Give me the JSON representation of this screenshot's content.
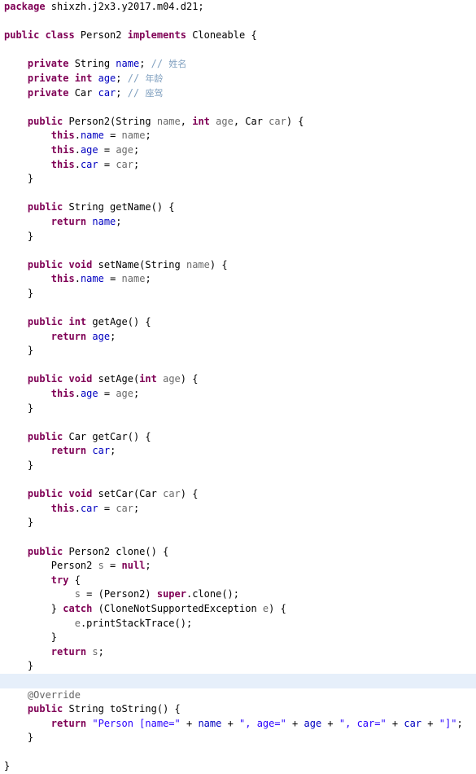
{
  "editor": {
    "language": "java",
    "filename": "Person2.java",
    "highlight_color": "#e6effa",
    "colors": {
      "background": "#ffffff",
      "keyword": "#7f0055",
      "field": "#0000c0",
      "string": "#2a00ff",
      "comment": "#7f9fbf",
      "annotation": "#646464",
      "local": "#6a6a6a",
      "plain": "#000000"
    },
    "lines": [
      {
        "indent": 0,
        "highlight": false,
        "tokens": [
          {
            "t": "package ",
            "c": "kw"
          },
          {
            "t": "shixzh.j2x3.y2017.m04.d21;",
            "c": "plain"
          }
        ]
      },
      {
        "indent": 0,
        "highlight": false,
        "tokens": []
      },
      {
        "indent": 0,
        "highlight": false,
        "tokens": [
          {
            "t": "public class ",
            "c": "kw"
          },
          {
            "t": "Person2 ",
            "c": "plain"
          },
          {
            "t": "implements ",
            "c": "kw"
          },
          {
            "t": "Cloneable {",
            "c": "plain"
          }
        ]
      },
      {
        "indent": 0,
        "highlight": false,
        "tokens": []
      },
      {
        "indent": 1,
        "highlight": false,
        "tokens": [
          {
            "t": "private ",
            "c": "kw"
          },
          {
            "t": "String ",
            "c": "plain"
          },
          {
            "t": "name",
            "c": "fld"
          },
          {
            "t": "; ",
            "c": "plain"
          },
          {
            "t": "// ",
            "c": "cmt"
          },
          {
            "t": "姓名",
            "c": "cmtz"
          }
        ]
      },
      {
        "indent": 1,
        "highlight": false,
        "tokens": [
          {
            "t": "private int ",
            "c": "kw"
          },
          {
            "t": "age",
            "c": "fld"
          },
          {
            "t": "; ",
            "c": "plain"
          },
          {
            "t": "// ",
            "c": "cmt"
          },
          {
            "t": "年龄",
            "c": "cmtz"
          }
        ]
      },
      {
        "indent": 1,
        "highlight": false,
        "tokens": [
          {
            "t": "private ",
            "c": "kw"
          },
          {
            "t": "Car ",
            "c": "plain"
          },
          {
            "t": "car",
            "c": "fld"
          },
          {
            "t": "; ",
            "c": "plain"
          },
          {
            "t": "// ",
            "c": "cmt"
          },
          {
            "t": "座驾",
            "c": "cmtz"
          }
        ]
      },
      {
        "indent": 0,
        "highlight": false,
        "tokens": []
      },
      {
        "indent": 1,
        "highlight": false,
        "tokens": [
          {
            "t": "public ",
            "c": "kw"
          },
          {
            "t": "Person2(String ",
            "c": "plain"
          },
          {
            "t": "name",
            "c": "par"
          },
          {
            "t": ", ",
            "c": "plain"
          },
          {
            "t": "int ",
            "c": "kw"
          },
          {
            "t": "age",
            "c": "par"
          },
          {
            "t": ", Car ",
            "c": "plain"
          },
          {
            "t": "car",
            "c": "par"
          },
          {
            "t": ") {",
            "c": "plain"
          }
        ]
      },
      {
        "indent": 2,
        "highlight": false,
        "tokens": [
          {
            "t": "this",
            "c": "kw"
          },
          {
            "t": ".",
            "c": "plain"
          },
          {
            "t": "name",
            "c": "fld"
          },
          {
            "t": " = ",
            "c": "plain"
          },
          {
            "t": "name",
            "c": "par"
          },
          {
            "t": ";",
            "c": "plain"
          }
        ]
      },
      {
        "indent": 2,
        "highlight": false,
        "tokens": [
          {
            "t": "this",
            "c": "kw"
          },
          {
            "t": ".",
            "c": "plain"
          },
          {
            "t": "age",
            "c": "fld"
          },
          {
            "t": " = ",
            "c": "plain"
          },
          {
            "t": "age",
            "c": "par"
          },
          {
            "t": ";",
            "c": "plain"
          }
        ]
      },
      {
        "indent": 2,
        "highlight": false,
        "tokens": [
          {
            "t": "this",
            "c": "kw"
          },
          {
            "t": ".",
            "c": "plain"
          },
          {
            "t": "car",
            "c": "fld"
          },
          {
            "t": " = ",
            "c": "plain"
          },
          {
            "t": "car",
            "c": "par"
          },
          {
            "t": ";",
            "c": "plain"
          }
        ]
      },
      {
        "indent": 1,
        "highlight": false,
        "tokens": [
          {
            "t": "}",
            "c": "plain"
          }
        ]
      },
      {
        "indent": 0,
        "highlight": false,
        "tokens": []
      },
      {
        "indent": 1,
        "highlight": false,
        "tokens": [
          {
            "t": "public ",
            "c": "kw"
          },
          {
            "t": "String getName() {",
            "c": "plain"
          }
        ]
      },
      {
        "indent": 2,
        "highlight": false,
        "tokens": [
          {
            "t": "return ",
            "c": "kw"
          },
          {
            "t": "name",
            "c": "fld"
          },
          {
            "t": ";",
            "c": "plain"
          }
        ]
      },
      {
        "indent": 1,
        "highlight": false,
        "tokens": [
          {
            "t": "}",
            "c": "plain"
          }
        ]
      },
      {
        "indent": 0,
        "highlight": false,
        "tokens": []
      },
      {
        "indent": 1,
        "highlight": false,
        "tokens": [
          {
            "t": "public void ",
            "c": "kw"
          },
          {
            "t": "setName(String ",
            "c": "plain"
          },
          {
            "t": "name",
            "c": "par"
          },
          {
            "t": ") {",
            "c": "plain"
          }
        ]
      },
      {
        "indent": 2,
        "highlight": false,
        "tokens": [
          {
            "t": "this",
            "c": "kw"
          },
          {
            "t": ".",
            "c": "plain"
          },
          {
            "t": "name",
            "c": "fld"
          },
          {
            "t": " = ",
            "c": "plain"
          },
          {
            "t": "name",
            "c": "par"
          },
          {
            "t": ";",
            "c": "plain"
          }
        ]
      },
      {
        "indent": 1,
        "highlight": false,
        "tokens": [
          {
            "t": "}",
            "c": "plain"
          }
        ]
      },
      {
        "indent": 0,
        "highlight": false,
        "tokens": []
      },
      {
        "indent": 1,
        "highlight": false,
        "tokens": [
          {
            "t": "public int ",
            "c": "kw"
          },
          {
            "t": "getAge() {",
            "c": "plain"
          }
        ]
      },
      {
        "indent": 2,
        "highlight": false,
        "tokens": [
          {
            "t": "return ",
            "c": "kw"
          },
          {
            "t": "age",
            "c": "fld"
          },
          {
            "t": ";",
            "c": "plain"
          }
        ]
      },
      {
        "indent": 1,
        "highlight": false,
        "tokens": [
          {
            "t": "}",
            "c": "plain"
          }
        ]
      },
      {
        "indent": 0,
        "highlight": false,
        "tokens": []
      },
      {
        "indent": 1,
        "highlight": false,
        "tokens": [
          {
            "t": "public void ",
            "c": "kw"
          },
          {
            "t": "setAge(",
            "c": "plain"
          },
          {
            "t": "int ",
            "c": "kw"
          },
          {
            "t": "age",
            "c": "par"
          },
          {
            "t": ") {",
            "c": "plain"
          }
        ]
      },
      {
        "indent": 2,
        "highlight": false,
        "tokens": [
          {
            "t": "this",
            "c": "kw"
          },
          {
            "t": ".",
            "c": "plain"
          },
          {
            "t": "age",
            "c": "fld"
          },
          {
            "t": " = ",
            "c": "plain"
          },
          {
            "t": "age",
            "c": "par"
          },
          {
            "t": ";",
            "c": "plain"
          }
        ]
      },
      {
        "indent": 1,
        "highlight": false,
        "tokens": [
          {
            "t": "}",
            "c": "plain"
          }
        ]
      },
      {
        "indent": 0,
        "highlight": false,
        "tokens": []
      },
      {
        "indent": 1,
        "highlight": false,
        "tokens": [
          {
            "t": "public ",
            "c": "kw"
          },
          {
            "t": "Car getCar() {",
            "c": "plain"
          }
        ]
      },
      {
        "indent": 2,
        "highlight": false,
        "tokens": [
          {
            "t": "return ",
            "c": "kw"
          },
          {
            "t": "car",
            "c": "fld"
          },
          {
            "t": ";",
            "c": "plain"
          }
        ]
      },
      {
        "indent": 1,
        "highlight": false,
        "tokens": [
          {
            "t": "}",
            "c": "plain"
          }
        ]
      },
      {
        "indent": 0,
        "highlight": false,
        "tokens": []
      },
      {
        "indent": 1,
        "highlight": false,
        "tokens": [
          {
            "t": "public void ",
            "c": "kw"
          },
          {
            "t": "setCar(Car ",
            "c": "plain"
          },
          {
            "t": "car",
            "c": "par"
          },
          {
            "t": ") {",
            "c": "plain"
          }
        ]
      },
      {
        "indent": 2,
        "highlight": false,
        "tokens": [
          {
            "t": "this",
            "c": "kw"
          },
          {
            "t": ".",
            "c": "plain"
          },
          {
            "t": "car",
            "c": "fld"
          },
          {
            "t": " = ",
            "c": "plain"
          },
          {
            "t": "car",
            "c": "par"
          },
          {
            "t": ";",
            "c": "plain"
          }
        ]
      },
      {
        "indent": 1,
        "highlight": false,
        "tokens": [
          {
            "t": "}",
            "c": "plain"
          }
        ]
      },
      {
        "indent": 0,
        "highlight": false,
        "tokens": []
      },
      {
        "indent": 1,
        "highlight": false,
        "tokens": [
          {
            "t": "public ",
            "c": "kw"
          },
          {
            "t": "Person2 clone() {",
            "c": "plain"
          }
        ]
      },
      {
        "indent": 2,
        "highlight": false,
        "tokens": [
          {
            "t": "Person2 ",
            "c": "plain"
          },
          {
            "t": "s",
            "c": "par"
          },
          {
            "t": " = ",
            "c": "plain"
          },
          {
            "t": "null",
            "c": "kw"
          },
          {
            "t": ";",
            "c": "plain"
          }
        ]
      },
      {
        "indent": 2,
        "highlight": false,
        "tokens": [
          {
            "t": "try ",
            "c": "kw"
          },
          {
            "t": "{",
            "c": "plain"
          }
        ]
      },
      {
        "indent": 3,
        "highlight": false,
        "tokens": [
          {
            "t": "s",
            "c": "par"
          },
          {
            "t": " = (Person2) ",
            "c": "plain"
          },
          {
            "t": "super",
            "c": "kw"
          },
          {
            "t": ".clone();",
            "c": "plain"
          }
        ]
      },
      {
        "indent": 2,
        "highlight": false,
        "tokens": [
          {
            "t": "} ",
            "c": "plain"
          },
          {
            "t": "catch ",
            "c": "kw"
          },
          {
            "t": "(CloneNotSupportedException ",
            "c": "plain"
          },
          {
            "t": "e",
            "c": "par"
          },
          {
            "t": ") {",
            "c": "plain"
          }
        ]
      },
      {
        "indent": 3,
        "highlight": false,
        "tokens": [
          {
            "t": "e",
            "c": "par"
          },
          {
            "t": ".printStackTrace();",
            "c": "plain"
          }
        ]
      },
      {
        "indent": 2,
        "highlight": false,
        "tokens": [
          {
            "t": "}",
            "c": "plain"
          }
        ]
      },
      {
        "indent": 2,
        "highlight": false,
        "tokens": [
          {
            "t": "return ",
            "c": "kw"
          },
          {
            "t": "s",
            "c": "par"
          },
          {
            "t": ";",
            "c": "plain"
          }
        ]
      },
      {
        "indent": 1,
        "highlight": false,
        "tokens": [
          {
            "t": "}",
            "c": "plain"
          }
        ]
      },
      {
        "indent": 0,
        "highlight": true,
        "tokens": []
      },
      {
        "indent": 1,
        "highlight": false,
        "tokens": [
          {
            "t": "@Override",
            "c": "anno"
          }
        ]
      },
      {
        "indent": 1,
        "highlight": false,
        "tokens": [
          {
            "t": "public ",
            "c": "kw"
          },
          {
            "t": "String toString() {",
            "c": "plain"
          }
        ]
      },
      {
        "indent": 2,
        "highlight": false,
        "tokens": [
          {
            "t": "return ",
            "c": "kw"
          },
          {
            "t": "\"Person [name=\"",
            "c": "str"
          },
          {
            "t": " + ",
            "c": "plain"
          },
          {
            "t": "name",
            "c": "fld"
          },
          {
            "t": " + ",
            "c": "plain"
          },
          {
            "t": "\", age=\"",
            "c": "str"
          },
          {
            "t": " + ",
            "c": "plain"
          },
          {
            "t": "age",
            "c": "fld"
          },
          {
            "t": " + ",
            "c": "plain"
          },
          {
            "t": "\", car=\"",
            "c": "str"
          },
          {
            "t": " + ",
            "c": "plain"
          },
          {
            "t": "car",
            "c": "fld"
          },
          {
            "t": " + ",
            "c": "plain"
          },
          {
            "t": "\"]\"",
            "c": "str"
          },
          {
            "t": ";",
            "c": "plain"
          }
        ]
      },
      {
        "indent": 1,
        "highlight": false,
        "tokens": [
          {
            "t": "}",
            "c": "plain"
          }
        ]
      },
      {
        "indent": 0,
        "highlight": false,
        "tokens": []
      },
      {
        "indent": 0,
        "highlight": false,
        "tokens": [
          {
            "t": "}",
            "c": "plain"
          }
        ]
      }
    ]
  }
}
